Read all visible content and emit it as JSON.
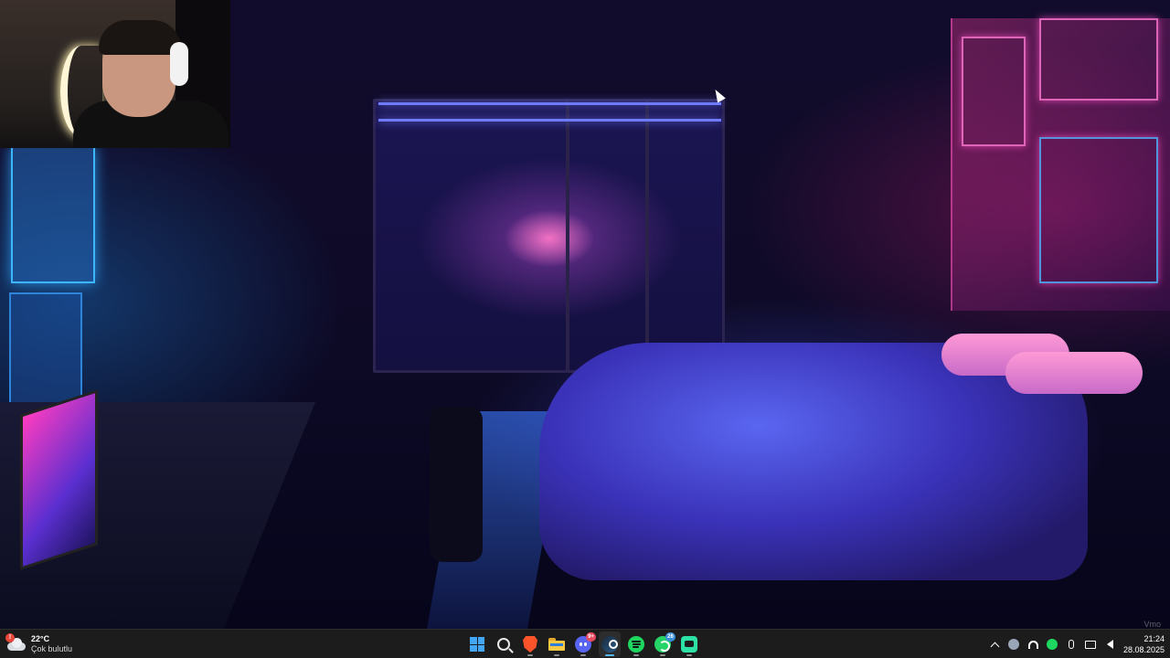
{
  "weather": {
    "temperature": "22°C",
    "condition": "Çok bulutlu",
    "icon": "cloud-icon",
    "badge": "!"
  },
  "taskbar": {
    "apps": [
      {
        "name": "start",
        "icon": "windows-icon",
        "active": false,
        "open": false
      },
      {
        "name": "search",
        "icon": "search-icon",
        "active": false,
        "open": false
      },
      {
        "name": "brave",
        "icon": "brave-browser-icon",
        "active": false,
        "open": true
      },
      {
        "name": "file-explorer",
        "icon": "folder-icon",
        "active": false,
        "open": true
      },
      {
        "name": "discord",
        "icon": "discord-icon",
        "active": false,
        "open": true,
        "badge": "9+"
      },
      {
        "name": "steam",
        "icon": "steam-icon",
        "active": true,
        "open": true
      },
      {
        "name": "spotify",
        "icon": "spotify-icon",
        "active": false,
        "open": true
      },
      {
        "name": "whatsapp",
        "icon": "whatsapp-icon",
        "active": false,
        "open": true,
        "badge": "26"
      },
      {
        "name": "chat-app",
        "icon": "chat-icon",
        "active": false,
        "open": true
      }
    ],
    "badges": {
      "discord": "9+",
      "whatsapp": "26"
    }
  },
  "tray": {
    "icons": [
      "chevron-up-icon",
      "steam-tray-icon",
      "headphones-icon",
      "spotify-tray-icon",
      "microphone-icon",
      "display-icon",
      "volume-icon"
    ]
  },
  "clock": {
    "time": "21:24",
    "date": "28.08.2025"
  },
  "colors": {
    "taskbar_bg": "#1c1c1c",
    "accent": "#58b6ff",
    "badge_red": "#e8473a",
    "discord_badge": "#e84a5f",
    "whatsapp_badge": "#3a8fd8"
  }
}
